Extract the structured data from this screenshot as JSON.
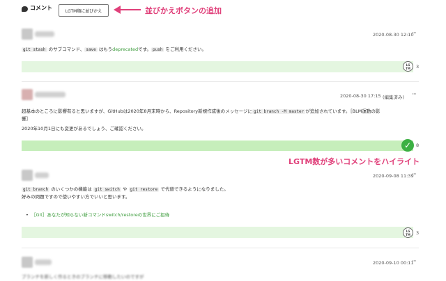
{
  "header": {
    "icon": "comment-icon",
    "title": "コメント",
    "sort_button": "LGTM順に並びかえ"
  },
  "annotations": {
    "sort_button_note": "並びかえボタンの追加",
    "highlight_note": "LGTM数が多いコメントをハイライト",
    "color": "#e0407a"
  },
  "comments": [
    {
      "date": "2020-08-30 12:10",
      "more": "···",
      "body": {
        "c1": "git stash",
        "t1": " のサブコマンド、",
        "c2": "save",
        "t2": " はもう",
        "dep": "deprecated",
        "t3": "です。",
        "c3": "push",
        "t4": " をご利用ください。"
      },
      "lgtm_icon": "lgtm-icon",
      "lgtm_count": "3"
    },
    {
      "date": "2020-08-30 17:15",
      "edited": "(編集済み)",
      "more": "···",
      "body": {
        "l1a": "超基本のところに影響有ると思いますが、GitHubは2020年8月末時から、Repository新規作成後のメッセージに",
        "l1c": "git branch -M master",
        "l1b": "が追加されています。［BLM運動の影",
        "l2": "響］",
        "l3": "2020年10月1日にも変更があるでしょう、ご確認ください。"
      },
      "lgtm_icon": "check-icon",
      "lgtm_count": "8",
      "highlighted": true
    },
    {
      "date": "2020-09-08 11:39",
      "more": "···",
      "body": {
        "c1": "git branch",
        "t1": " のいくつかの機能は ",
        "c2": "git switch",
        "t2": " や ",
        "c3": "git restore",
        "t3": " で代替できるようになりました。",
        "l2": "好みの問題ですので使いやすい方でいいと思います。",
        "link": "［Git］あなたが知らない新コマンドswitch/restoreの世界にご招待"
      },
      "lgtm_icon": "lgtm-icon",
      "lgtm_count": "3"
    },
    {
      "date": "2020-09-10 00:11",
      "more": "···",
      "body": {
        "l1": "ブランチを新しく作るときのブランチに移動したいのですが"
      }
    }
  ]
}
